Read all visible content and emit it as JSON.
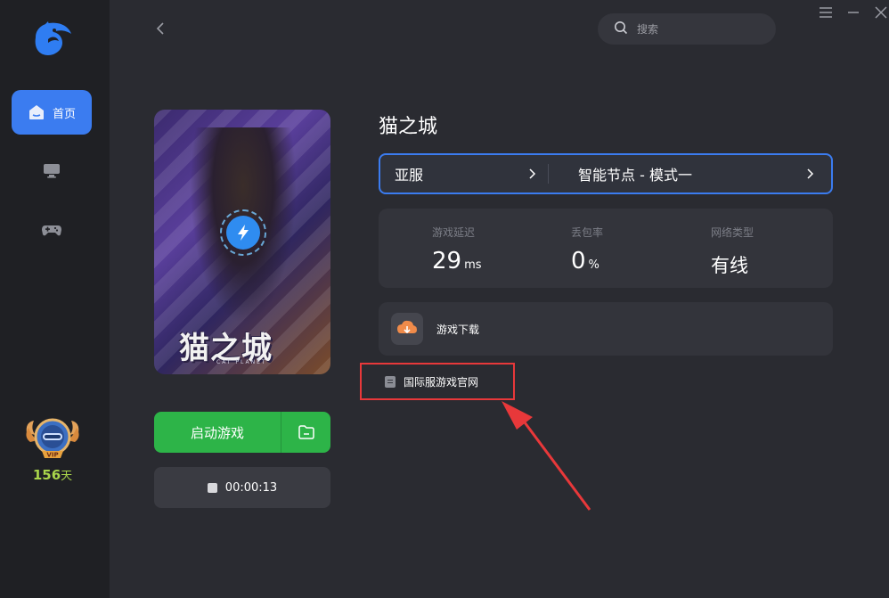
{
  "sidebar": {
    "items": [
      {
        "label": "首页",
        "icon": "home-icon",
        "active": true
      },
      {
        "label": "",
        "icon": "monitor-icon",
        "active": false
      },
      {
        "label": "",
        "icon": "gamepad-icon",
        "active": false
      }
    ],
    "vip": {
      "badge": "VIP",
      "days": "156",
      "unit": "天"
    }
  },
  "header": {
    "search_placeholder": "搜索"
  },
  "game": {
    "cover_logo": "猫之城",
    "cover_sub": "CAT PLANET",
    "title": "猫之城",
    "region": "亚服",
    "node": "智能节点 - 模式一",
    "launch_label": "启动游戏",
    "timer": "00:00:13"
  },
  "stats": [
    {
      "label": "游戏延迟",
      "value": "29",
      "unit": "ms"
    },
    {
      "label": "丢包率",
      "value": "0",
      "unit": "%"
    },
    {
      "label": "网络类型",
      "value": "有线",
      "unit": ""
    }
  ],
  "download": {
    "label": "游戏下载"
  },
  "official_site": {
    "label": "国际服游戏官网"
  },
  "colors": {
    "accent": "#3b7cf0",
    "launch": "#2db448",
    "highlight": "#e8383a",
    "vip_days": "#a9d54b"
  }
}
